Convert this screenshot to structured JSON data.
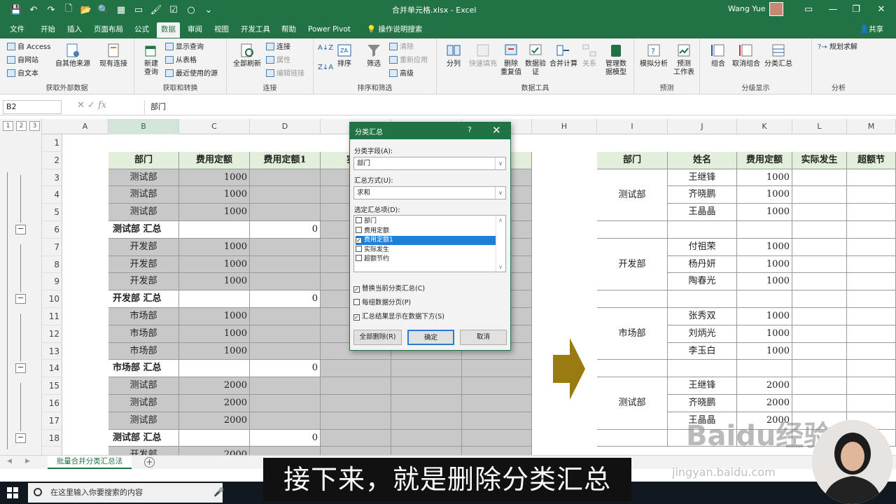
{
  "titlebar": {
    "doc_title": "合并单元格.xlsx  -  Excel",
    "user_name": "Wang Yue",
    "qat_icons": [
      "save-icon",
      "undo-icon",
      "redo-icon",
      "new-file-icon",
      "open-icon",
      "print-preview-icon",
      "table-icon",
      "screenshot-icon",
      "brush-icon",
      "check-icon",
      "circle-icon",
      "customize-icon"
    ]
  },
  "tabs": [
    "文件",
    "开始",
    "插入",
    "页面布局",
    "公式",
    "数据",
    "审阅",
    "视图",
    "开发工具",
    "帮助",
    "Power Pivot",
    "操作说明搜索"
  ],
  "share": "共享",
  "ribbon": {
    "get_external": {
      "label": "获取外部数据",
      "access": "自 Access",
      "web": "自网站",
      "text": "自文本",
      "other": "自其他来源",
      "existing": "现有连接"
    },
    "get_transform": {
      "label": "获取和转换",
      "new_query": "新建\n查询",
      "show_queries": "显示查询",
      "from_table": "从表格",
      "recent": "最近使用的源"
    },
    "connections": {
      "label": "连接",
      "refresh_all": "全部刷新",
      "connections": "连接",
      "properties": "属性",
      "edit_links": "编辑链接"
    },
    "sort_filter": {
      "label": "排序和筛选",
      "sort": "排序",
      "filter": "筛选",
      "clear": "清除",
      "reapply": "重新应用",
      "advanced": "高级"
    },
    "data_tools": {
      "label": "数据工具",
      "split": "分列",
      "flash_fill": "快速填充",
      "remove_dup": "删除\n重复值",
      "validation": "数据验\n证",
      "consolidate": "合并计算",
      "relations": "关系",
      "data_model": "管理数\n据模型"
    },
    "forecast": {
      "label": "预测",
      "whatif": "模拟分析",
      "forecast_sheet": "预测\n工作表"
    },
    "outline": {
      "label": "分级显示",
      "group": "组合",
      "ungroup": "取消组合",
      "subtotal": "分类汇总"
    },
    "analysis": {
      "label": "分析",
      "solver": "规划求解"
    }
  },
  "formula_bar": {
    "name_box": "B2",
    "formula": "部门"
  },
  "columns": [
    "A",
    "B",
    "C",
    "D",
    "E",
    "F",
    "G",
    "H",
    "I",
    "J",
    "K",
    "L",
    "M"
  ],
  "outline_levels": [
    "1",
    "2",
    "3"
  ],
  "rows": [
    "1",
    "2",
    "3",
    "4",
    "5",
    "6",
    "7",
    "8",
    "9",
    "10",
    "11",
    "12",
    "13",
    "14",
    "15",
    "16",
    "17",
    "18"
  ],
  "left_table": {
    "headers": [
      "部门",
      "费用定额",
      "费用定额1",
      "实际"
    ],
    "rows": [
      {
        "dept": "测试部",
        "val": "1000",
        "sum": ""
      },
      {
        "dept": "测试部",
        "val": "1000",
        "sum": ""
      },
      {
        "dept": "测试部",
        "val": "1000",
        "sum": ""
      },
      {
        "dept": "测试部  汇总",
        "val": "",
        "sum": "0",
        "total": true
      },
      {
        "dept": "开发部",
        "val": "1000",
        "sum": ""
      },
      {
        "dept": "开发部",
        "val": "1000",
        "sum": ""
      },
      {
        "dept": "开发部",
        "val": "1000",
        "sum": ""
      },
      {
        "dept": "开发部  汇总",
        "val": "",
        "sum": "0",
        "total": true
      },
      {
        "dept": "市场部",
        "val": "1000",
        "sum": ""
      },
      {
        "dept": "市场部",
        "val": "1000",
        "sum": ""
      },
      {
        "dept": "市场部",
        "val": "1000",
        "sum": ""
      },
      {
        "dept": "市场部  汇总",
        "val": "",
        "sum": "0",
        "total": true
      },
      {
        "dept": "测试部",
        "val": "2000",
        "sum": ""
      },
      {
        "dept": "测试部",
        "val": "2000",
        "sum": ""
      },
      {
        "dept": "测试部",
        "val": "2000",
        "sum": ""
      },
      {
        "dept": "测试部  汇总",
        "val": "",
        "sum": "0",
        "total": true
      },
      {
        "dept": "开发部",
        "val": "2000",
        "sum": ""
      }
    ]
  },
  "right_table": {
    "headers": [
      "部门",
      "姓名",
      "费用定额",
      "实际发生",
      "超额节"
    ],
    "groups": [
      {
        "dept": "测试部",
        "people": [
          {
            "name": "王继锋",
            "val": "1000"
          },
          {
            "name": "齐晓鹏",
            "val": "1000"
          },
          {
            "name": "王晶晶",
            "val": "1000"
          }
        ]
      },
      {
        "dept": "开发部",
        "people": [
          {
            "name": "付祖荣",
            "val": "1000"
          },
          {
            "name": "杨丹妍",
            "val": "1000"
          },
          {
            "name": "陶春光",
            "val": "1000"
          }
        ]
      },
      {
        "dept": "市场部",
        "people": [
          {
            "name": "张秀双",
            "val": "1000"
          },
          {
            "name": "刘炳光",
            "val": "1000"
          },
          {
            "name": "李玉白",
            "val": "1000"
          }
        ]
      },
      {
        "dept": "测试部",
        "people": [
          {
            "name": "王继锋",
            "val": "2000"
          },
          {
            "name": "齐晓鹏",
            "val": "2000"
          },
          {
            "name": "王晶晶",
            "val": "2000"
          }
        ]
      }
    ]
  },
  "dialog": {
    "title": "分类汇总",
    "help": "?",
    "group_by_label": "分类字段(A):",
    "group_by_value": "部门",
    "function_label": "汇总方式(U):",
    "function_value": "求和",
    "items_label": "选定汇总项(D):",
    "items": [
      {
        "label": "部门",
        "checked": false,
        "selected": false
      },
      {
        "label": "费用定额",
        "checked": false,
        "selected": false
      },
      {
        "label": "费用定额1",
        "checked": true,
        "selected": true
      },
      {
        "label": "实际发生",
        "checked": false,
        "selected": false
      },
      {
        "label": "超额节约",
        "checked": false,
        "selected": false
      }
    ],
    "replace_current": "替换当前分类汇总(C)",
    "page_break": "每组数据分页(P)",
    "summary_below": "汇总结果显示在数据下方(S)",
    "remove_all": "全部删除(R)",
    "ok": "确定",
    "cancel": "取消"
  },
  "sheet_tab": "批量合并分类汇总法",
  "taskbar": {
    "search_placeholder": "在这里输入你要搜索的内容"
  },
  "subtitle": "接下来，就是删除分类汇总",
  "watermark": "Baidu经验",
  "watermark_sub": "jingyan.baidu.com",
  "colors": {
    "excel_green": "#217346",
    "selected_blue": "#1e7fd8",
    "arrow": "#9a7b10"
  }
}
